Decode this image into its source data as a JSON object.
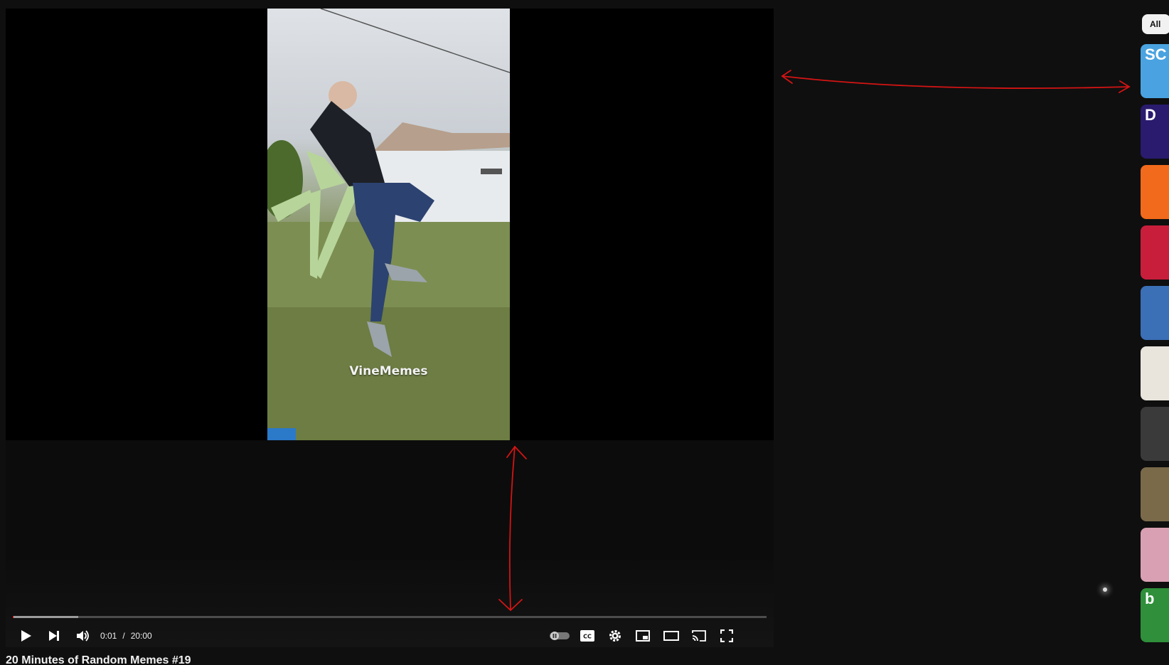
{
  "video": {
    "watermark": "VineMemes",
    "title": "20 Minutes of Random Memes #19"
  },
  "player": {
    "current_time": "0:01",
    "separator": "/",
    "duration": "20:00",
    "progress_played_fraction": 0.001,
    "progress_loaded_fraction": 0.087
  },
  "controls": {
    "play": "play-icon",
    "next": "next-icon",
    "volume": "volume-icon",
    "autoplay": "autoplay-toggle-icon",
    "captions": "captions-icon",
    "settings": "gear-icon",
    "miniplayer": "miniplayer-icon",
    "theater": "theater-mode-icon",
    "cast": "cast-icon",
    "fullscreen": "fullscreen-icon"
  },
  "sidebar": {
    "chip_label": "All",
    "thumbnails": [
      {
        "glyph": "SC",
        "color": "#4aa3e0"
      },
      {
        "glyph": "D",
        "color": "#2a1b6e"
      },
      {
        "glyph": "",
        "color": "#f26a1b"
      },
      {
        "glyph": "",
        "color": "#c81e3c"
      },
      {
        "glyph": "",
        "color": "#3b6fb6"
      },
      {
        "glyph": "",
        "color": "#e9e4dc"
      },
      {
        "glyph": "",
        "color": "#3a3a3a"
      },
      {
        "glyph": "",
        "color": "#7a6a4a"
      },
      {
        "glyph": "",
        "color": "#d9a0b3"
      },
      {
        "glyph": "b",
        "color": "#2f8f3a"
      }
    ]
  },
  "annotation_color": "#d41414"
}
